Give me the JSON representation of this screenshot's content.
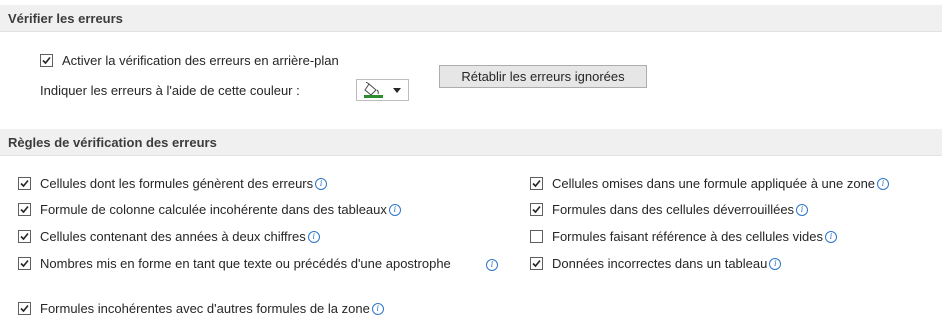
{
  "section1": {
    "title": "Vérifier les erreurs"
  },
  "background_check": {
    "label": "Activer la vérification des erreurs en arrière-plan",
    "checked": true
  },
  "color": {
    "label": "Indiquer les erreurs à l'aide de cette couleur :",
    "value": "#2e8b2e",
    "icon": "paint-bucket-icon"
  },
  "reset_button": {
    "label": "Rétablir les erreurs ignorées"
  },
  "section2": {
    "title": "Règles de vérification des erreurs"
  },
  "rules_left": [
    {
      "label": "Cellules dont les formules génèrent des erreurs",
      "checked": true
    },
    {
      "label": "Formule de colonne calculée incohérente dans des tableaux",
      "checked": true
    },
    {
      "label": "Cellules contenant des années à deux chiffres",
      "checked": true
    },
    {
      "label": "Nombres mis en forme en tant que texte ou précédés d'une apostrophe",
      "checked": true
    },
    {
      "label": "Formules incohérentes avec d'autres formules de la zone",
      "checked": true
    }
  ],
  "rules_right": [
    {
      "label": "Cellules omises dans une formule appliquée à une zone",
      "checked": true
    },
    {
      "label": "Formules dans des cellules déverrouillées",
      "checked": true
    },
    {
      "label": "Formules faisant référence à des cellules vides",
      "checked": false
    },
    {
      "label": "Données incorrectes dans un tableau",
      "checked": true
    }
  ],
  "info_glyph": "i"
}
